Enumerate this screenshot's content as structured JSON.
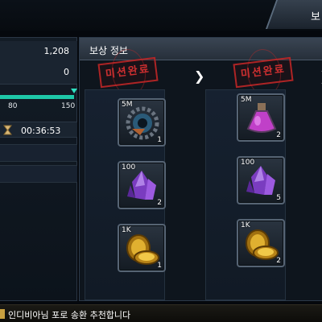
{
  "top_tab": {
    "label": "보"
  },
  "left_panel": {
    "stat1": "1,208",
    "stat2": "0",
    "progress": {
      "value": 150,
      "max": 150,
      "tick_low": "80",
      "tick_high": "150"
    },
    "timer": "00:36:53"
  },
  "reward_panel": {
    "title": "보상 정보",
    "stamp_text": "미션완료",
    "columns": [
      {
        "items": [
          {
            "tag": "5M",
            "count": "1",
            "icon": "gear-icon"
          },
          {
            "tag": "100",
            "count": "2",
            "icon": "crystal-icon"
          },
          {
            "tag": "1K",
            "count": "1",
            "icon": "coin-icon"
          }
        ]
      },
      {
        "items": [
          {
            "tag": "5M",
            "count": "2",
            "icon": "potion-icon"
          },
          {
            "tag": "100",
            "count": "5",
            "icon": "crystal-icon"
          },
          {
            "tag": "1K",
            "count": "2",
            "icon": "coin-icon"
          }
        ]
      }
    ]
  },
  "ticker": {
    "text": "인디비아님 포로 송환 추천합니다"
  }
}
